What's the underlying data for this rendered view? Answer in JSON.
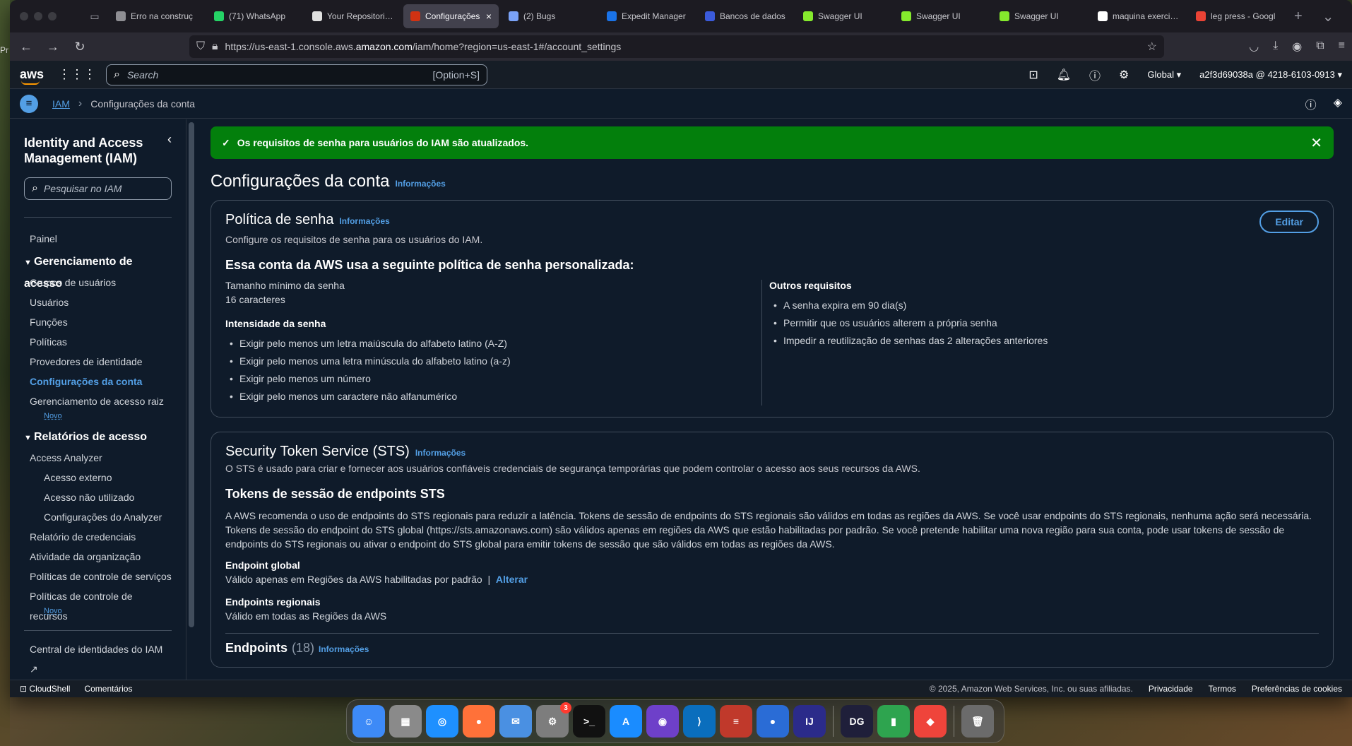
{
  "desktop": {
    "left_text": "Pr"
  },
  "browser": {
    "tabs": [
      {
        "label": "Erro na construç",
        "color": "#8e8e93",
        "active": false
      },
      {
        "label": "(71) WhatsApp",
        "color": "#25d366",
        "active": false
      },
      {
        "label": "Your Repositories",
        "color": "#e0e0e0",
        "active": false
      },
      {
        "label": "Configurações",
        "color": "#d13212",
        "active": true
      },
      {
        "label": "(2) Bugs",
        "color": "#7aa2f7",
        "active": false
      },
      {
        "label": "Expedit Manager",
        "color": "#1a73e8",
        "active": false
      },
      {
        "label": "Bancos de dados",
        "color": "#3b5bdb",
        "active": false
      },
      {
        "label": "Swagger UI",
        "color": "#85ea2d",
        "active": false
      },
      {
        "label": "Swagger UI",
        "color": "#85ea2d",
        "active": false
      },
      {
        "label": "Swagger UI",
        "color": "#85ea2d",
        "active": false
      },
      {
        "label": "maquina exercicio",
        "color": "#ffffff",
        "active": false
      },
      {
        "label": "leg press - Googl",
        "color": "#ea4335",
        "active": false
      }
    ],
    "url_prefix": "https://us-east-1.console.aws.",
    "url_domain": "amazon.com",
    "url_suffix": "/iam/home?region=us-east-1#/account_settings"
  },
  "aws_header": {
    "logo": "aws",
    "search_placeholder": "Search",
    "search_shortcut": "[Option+S]",
    "region": "Global",
    "account": "a2f3d69038a @ 4218-6103-0913"
  },
  "breadcrumb": {
    "root": "IAM",
    "current": "Configurações da conta"
  },
  "sidebar": {
    "title": "Identity and Access Management (IAM)",
    "search_placeholder": "Pesquisar no IAM",
    "panel": "Painel",
    "access_mgmt_header": "Gerenciamento de acesso",
    "access_mgmt_items": [
      "Grupos de usuários",
      "Usuários",
      "Funções",
      "Políticas",
      "Provedores de identidade",
      "Configurações da conta",
      "Gerenciamento de acesso raiz"
    ],
    "new_badge": "Novo",
    "reports_header": "Relatórios de acesso",
    "access_analyzer": "Access Analyzer",
    "analyzer_items": [
      "Acesso externo",
      "Acesso não utilizado",
      "Configurações do Analyzer"
    ],
    "report_items": [
      "Relatório de credenciais",
      "Atividade da organização",
      "Políticas de controle de serviços",
      "Políticas de controle de recursos"
    ],
    "identity_center": "Central de identidades do IAM"
  },
  "flash": {
    "message": "Os requisitos de senha para usuários do IAM são atualizados."
  },
  "page": {
    "title": "Configurações da conta",
    "info": "Informações"
  },
  "password_policy": {
    "title": "Política de senha",
    "info": "Informações",
    "desc": "Configure os requisitos de senha para os usuários do IAM.",
    "edit": "Editar",
    "heading": "Essa conta da AWS usa a seguinte política de senha personalizada:",
    "min_len_label": "Tamanho mínimo da senha",
    "min_len_value": "16 caracteres",
    "strength_label": "Intensidade da senha",
    "strength_items": [
      "Exigir pelo menos um letra maiúscula do alfabeto latino (A-Z)",
      "Exigir pelo menos uma letra minúscula do alfabeto latino (a-z)",
      "Exigir pelo menos um número",
      "Exigir pelo menos um caractere não alfanumérico"
    ],
    "other_label": "Outros requisitos",
    "other_items": [
      "A senha expira em 90 dia(s)",
      "Permitir que os usuários alterem a própria senha",
      "Impedir a reutilização de senhas das 2 alterações anteriores"
    ]
  },
  "sts": {
    "title": "Security Token Service (STS)",
    "info": "Informações",
    "desc": "O STS é usado para criar e fornecer aos usuários confiáveis credenciais de segurança temporárias que podem controlar o acesso aos seus recursos da AWS.",
    "tokens_heading": "Tokens de sessão de endpoints STS",
    "tokens_text": "A AWS recomenda o uso de endpoints do STS regionais para reduzir a latência. Tokens de sessão de endpoints do STS regionais são válidos em todas as regiões da AWS. Se você usar endpoints do STS regionais, nenhuma ação será necessária. Tokens de sessão do endpoint do STS global (https://sts.amazonaws.com) são válidos apenas em regiões da AWS que estão habilitadas por padrão. Se você pretende habilitar uma nova região para sua conta, pode usar tokens de sessão de endpoints do STS regionais ou ativar o endpoint do STS global para emitir tokens de sessão que são válidos em todas as regiões da AWS.",
    "global_label": "Endpoint global",
    "global_value": "Válido apenas em Regiões da AWS habilitadas por padrão",
    "change": "Alterar",
    "regional_label": "Endpoints regionais",
    "regional_value": "Válido em todas as Regiões da AWS",
    "endpoints_label": "Endpoints",
    "endpoints_count": "(18)"
  },
  "footer": {
    "cloudshell": "CloudShell",
    "feedback": "Comentários",
    "copyright": "© 2025, Amazon Web Services, Inc. ou suas afiliadas.",
    "privacy": "Privacidade",
    "terms": "Termos",
    "cookies": "Preferências de cookies"
  },
  "dock": {
    "apps": [
      {
        "name": "finder",
        "color": "#3d8af7",
        "glyph": "☺"
      },
      {
        "name": "launchpad",
        "color": "#8a8a8a",
        "glyph": "▦"
      },
      {
        "name": "safari",
        "color": "#1e90ff",
        "glyph": "◎"
      },
      {
        "name": "firefox",
        "color": "#ff7139",
        "glyph": "●"
      },
      {
        "name": "mail",
        "color": "#4a90e2",
        "glyph": "✉"
      },
      {
        "name": "system-settings",
        "color": "#7d7d7d",
        "glyph": "⚙",
        "badge": "3"
      },
      {
        "name": "terminal",
        "color": "#111111",
        "glyph": ">_"
      },
      {
        "name": "app-store",
        "color": "#1a8cff",
        "glyph": "A"
      },
      {
        "name": "github-desktop",
        "color": "#6e40c9",
        "glyph": "◉"
      },
      {
        "name": "vscode",
        "color": "#0a6ebd",
        "glyph": "⟩"
      },
      {
        "name": "redis",
        "color": "#c0392b",
        "glyph": "≡"
      },
      {
        "name": "firefox-dev",
        "color": "#2a6cd6",
        "glyph": "●"
      },
      {
        "name": "intellij",
        "color": "#2b2b8a",
        "glyph": "IJ"
      },
      {
        "name": "datagrip",
        "color": "#1f1f3a",
        "glyph": "DG"
      },
      {
        "name": "numbers",
        "color": "#2ea44f",
        "glyph": "▮"
      },
      {
        "name": "anydesk",
        "color": "#ef443b",
        "glyph": "◆"
      },
      {
        "name": "trash",
        "color": "#6b6b6b",
        "glyph": "🗑"
      }
    ]
  }
}
